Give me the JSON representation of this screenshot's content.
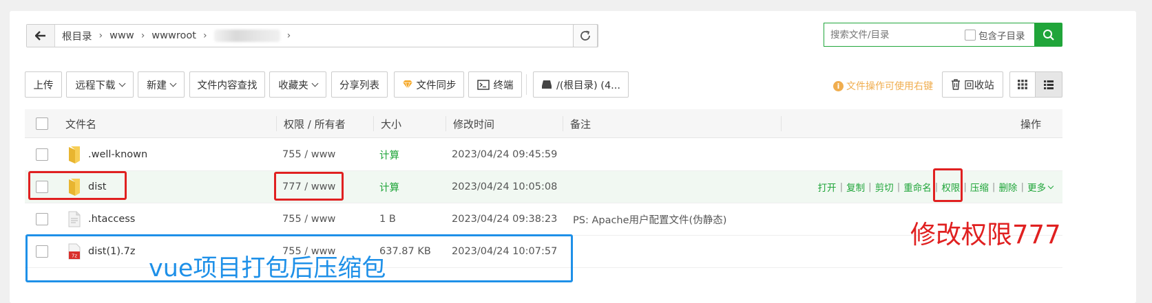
{
  "breadcrumb": {
    "items": [
      "根目录",
      "www",
      "wwwroot"
    ]
  },
  "search": {
    "placeholder": "搜索文件/目录",
    "subdir_label": "包含子目录"
  },
  "toolbar": {
    "upload": "上传",
    "remote_download": "远程下载",
    "new": "新建",
    "content_search": "文件内容查找",
    "favorites": "收藏夹",
    "share_list": "分享列表",
    "file_sync": "文件同步",
    "terminal": "终端",
    "disk": "/(根目录) (4...",
    "tip": "文件操作可使用右键",
    "recycle": "回收站"
  },
  "table": {
    "headers": {
      "name": "文件名",
      "perm": "权限 / 所有者",
      "size": "大小",
      "mtime": "修改时间",
      "note": "备注",
      "ops": "操作"
    },
    "rows": [
      {
        "name": ".well-known",
        "perm": "755 / www",
        "size": "计算",
        "mtime": "2023/04/24 09:45:59",
        "note": "",
        "type": "folder"
      },
      {
        "name": "dist",
        "perm": "777 / www",
        "size": "计算",
        "mtime": "2023/04/24 10:05:08",
        "note": "",
        "type": "folder"
      },
      {
        "name": ".htaccess",
        "perm": "755 / www",
        "size": "1 B",
        "mtime": "2023/04/24 09:38:23",
        "note": "PS: Apache用户配置文件(伪静态)",
        "type": "file"
      },
      {
        "name": "dist(1).7z",
        "perm": "755 / www",
        "size": "637.87 KB",
        "mtime": "2023/04/24 10:07:57",
        "note": "",
        "type": "archive"
      }
    ],
    "row_ops": {
      "open": "打开",
      "copy": "复制",
      "cut": "剪切",
      "rename": "重命名",
      "perm": "权限",
      "compress": "压缩",
      "delete": "删除",
      "more": "更多"
    }
  },
  "annotations": {
    "red_text": "修改权限777",
    "blue_text": "vue项目打包后压缩包"
  },
  "colors": {
    "accent": "#20a53a",
    "warn": "#f0ad4e",
    "annotation_red": "#e02020",
    "annotation_blue": "#1e90e8"
  }
}
